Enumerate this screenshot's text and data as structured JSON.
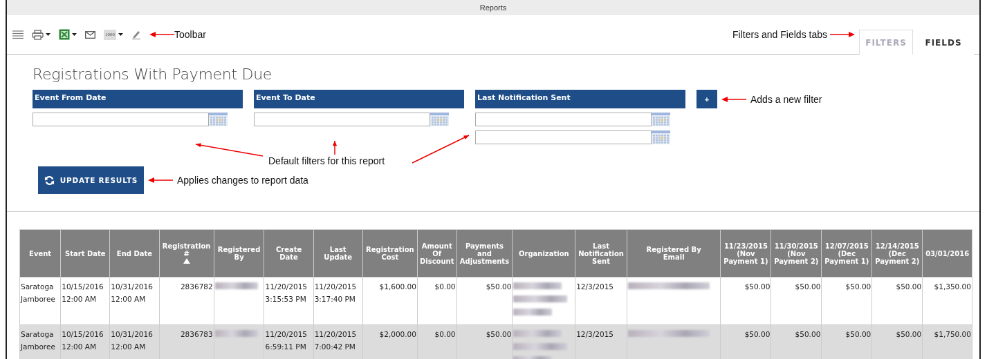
{
  "window": {
    "title": "Reports"
  },
  "toolbar": {
    "items": [
      {
        "kind": "menu",
        "dropdown": false
      },
      {
        "kind": "print",
        "dropdown": true
      },
      {
        "kind": "excel",
        "dropdown": true
      },
      {
        "kind": "email",
        "dropdown": false
      },
      {
        "kind": "count",
        "label": "1000",
        "dropdown": true
      },
      {
        "kind": "edit",
        "dropdown": false
      }
    ]
  },
  "tabs": [
    {
      "label": "FILTERS",
      "selected": true
    },
    {
      "label": "FIELDS",
      "selected": false
    }
  ],
  "report_title": "Registrations With Payment Due",
  "filters": [
    {
      "label": "Event From Date",
      "kind": "single"
    },
    {
      "label": "Event To Date",
      "kind": "single"
    },
    {
      "label": "Last Notification Sent",
      "kind": "range"
    }
  ],
  "add_filter_button": "+",
  "update_button": "UPDATE RESULTS",
  "annotations": {
    "toolbar": "Toolbar",
    "tabs": "Filters and Fields tabs",
    "add_filter": "Adds a new filter",
    "default_filters": "Default filters for this report",
    "update": "Applies changes to report data"
  },
  "table": {
    "columns": [
      {
        "label": "Event",
        "kind": "text",
        "sort_ascending": false
      },
      {
        "label": "Start Date",
        "kind": "text",
        "sort_ascending": false
      },
      {
        "label": "End Date",
        "kind": "text",
        "sort_ascending": false
      },
      {
        "label": "Registration\n#",
        "kind": "number",
        "sort_ascending": true
      },
      {
        "label": "Registered\nBy",
        "kind": "text",
        "sort_ascending": false
      },
      {
        "label": "Create\nDate",
        "kind": "text",
        "sort_ascending": false
      },
      {
        "label": "Last\nUpdate",
        "kind": "text",
        "sort_ascending": false
      },
      {
        "label": "Registration\nCost",
        "kind": "number",
        "sort_ascending": false
      },
      {
        "label": "Amount\nOf\nDiscount",
        "kind": "number",
        "sort_ascending": false
      },
      {
        "label": "Payments\nand\nAdjustments",
        "kind": "number",
        "sort_ascending": false
      },
      {
        "label": "Organization",
        "kind": "text",
        "sort_ascending": false
      },
      {
        "label": "Last\nNotification\nSent",
        "kind": "text",
        "sort_ascending": false
      },
      {
        "label": "Registered By\nEmail",
        "kind": "text",
        "sort_ascending": false
      },
      {
        "label": "11/23/2015\n(Nov\nPayment 1)",
        "kind": "number",
        "sort_ascending": false
      },
      {
        "label": "11/30/2015\n(Nov\nPayment 2)",
        "kind": "number",
        "sort_ascending": false
      },
      {
        "label": "12/07/2015\n(Dec\nPayment 1)",
        "kind": "number",
        "sort_ascending": false
      },
      {
        "label": "12/14/2015\n(Dec\nPayment 2)",
        "kind": "number",
        "sort_ascending": false
      },
      {
        "label": "03/01/2016",
        "kind": "number",
        "sort_ascending": false
      }
    ],
    "rows": [
      {
        "cells": [
          "Saratoga\nJamboree",
          "10/15/2016\n12:00 AM",
          "10/31/2016\n12:00 AM",
          "2836782",
          {
            "kind": "blurred"
          },
          "11/20/2015\n3:15:53 PM",
          "11/20/2015\n3:17:40 PM",
          "$1,600.00",
          "$0.00",
          "$50.00",
          {
            "kind": "blurred_multiline"
          },
          "12/3/2015",
          {
            "kind": "blurred"
          },
          "$50.00",
          "$50.00",
          "$50.00",
          "$50.00",
          "$1,350.00"
        ]
      },
      {
        "cells": [
          "Saratoga\nJamboree",
          "10/15/2016\n12:00 AM",
          "10/31/2016\n12:00 AM",
          "2836783",
          {
            "kind": "blurred"
          },
          "11/20/2015\n6:59:11 PM",
          "11/20/2015\n7:00:42 PM",
          "$2,000.00",
          "$0.00",
          "$50.00",
          {
            "kind": "blurred_multiline"
          },
          "12/3/2015",
          {
            "kind": "blurred"
          },
          "$50.00",
          "$50.00",
          "$50.00",
          "$50.00",
          "$1,750.00"
        ]
      }
    ]
  }
}
